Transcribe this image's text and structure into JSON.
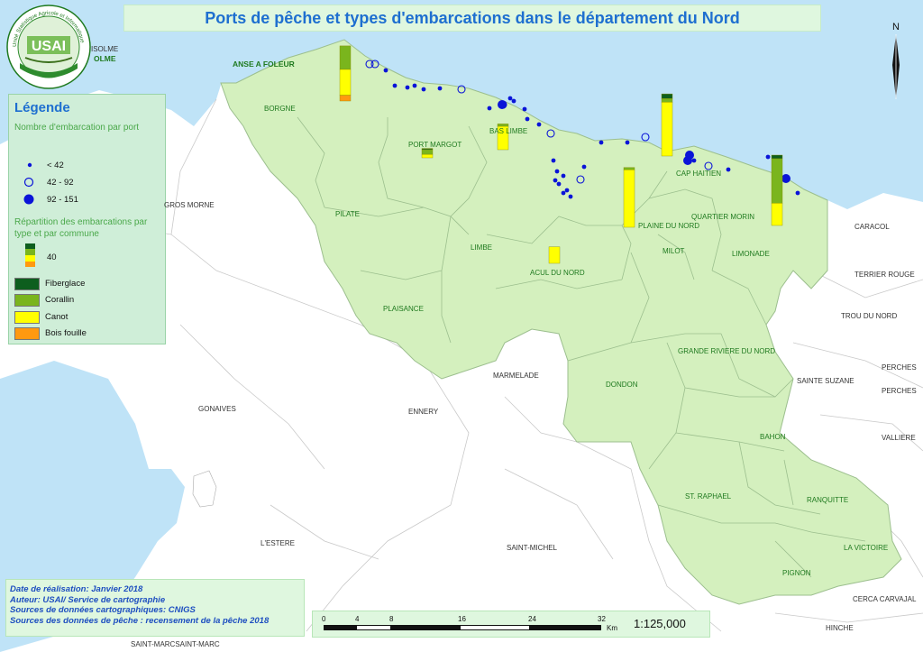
{
  "title": "Ports de pêche et types d'embarcations dans le département du Nord",
  "logo_text": "USAI",
  "logo_ring_text": "Unité Statistique Agricole et Informatique",
  "north_label": "N",
  "legend": {
    "title": "Légende",
    "port_heading": "Nombre d'embarcation par port",
    "port_classes": [
      "< 42",
      "42  - 92",
      "92 - 151"
    ],
    "commune_heading": "Répartition des embarcations par type et par commune",
    "sample_value": "40",
    "types": [
      {
        "label": "Fiberglace",
        "color": "#0d5e1e"
      },
      {
        "label": "Corallin",
        "color": "#7ab51d"
      },
      {
        "label": "Canot",
        "color": "#ffff00"
      },
      {
        "label": "Bois fouille",
        "color": "#ff9910"
      }
    ]
  },
  "footer": {
    "date": "Date de réalisation: Janvier 2018",
    "author": "Auteur: USAI/ Service de cartographie",
    "sources_carto": "Sources de données cartographiques: CNIGS",
    "sources_peche": "Sources des données de pêche : recensement de la pêche 2018"
  },
  "scale": {
    "ticks": [
      "0",
      "4",
      "8",
      "16",
      "24",
      "32"
    ],
    "unit": "Km",
    "ratio": "1:125,000"
  },
  "colors": {
    "sea": "#bfe3f7",
    "nord": "#d4f0be",
    "other_land": "#ffffff",
    "port_marker": "#0a14d8"
  },
  "communes_nord": [
    "BORGNE",
    "PORT MARGOT",
    "BAS LIMBE",
    "PILATE",
    "LIMBE",
    "ACUL DU NORD",
    "PLAINE DU NORD",
    "CAP HAITIEN",
    "QUARTIER MORIN",
    "MILOT",
    "LIMONADE",
    "PLAISANCE",
    "DONDON",
    "GRANDE RIVIERE DU NORD",
    "BAHON",
    "ST. RAPHAEL",
    "RANQUITTE",
    "LA VICTOIRE",
    "PIGNON"
  ],
  "other_communes": [
    "ANSE A FOLEUR",
    "ISOLME",
    "OLME",
    "GROS MORNE",
    "MARMELADE",
    "ENNERY",
    "GONAIVES",
    "L'ESTERE",
    "SAINT-MICHEL",
    "CARACOL",
    "TERRIER ROUGE",
    "TROU DU NORD",
    "PERCHES",
    "SAINTE SUZANE",
    "PERCHES",
    "VALLIERE",
    "CERCA CARVAJAL",
    "HINCHE",
    "SAINT-MARCSAINT-MARC"
  ],
  "commune_bars": [
    {
      "commune": "BORGNE",
      "fiberglace": 0,
      "corallin": 20,
      "canot": 22,
      "bois_fouille": 5
    },
    {
      "commune": "PORT MARGOT",
      "fiberglace": 1,
      "corallin": 4,
      "canot": 3,
      "bois_fouille": 0
    },
    {
      "commune": "BAS LIMBE",
      "fiberglace": 0,
      "corallin": 2,
      "canot": 20,
      "bois_fouille": 0
    },
    {
      "commune": "CAP HAITIEN",
      "fiberglace": 4,
      "corallin": 3,
      "canot": 46,
      "bois_fouille": 0
    },
    {
      "commune": "PLAINE DU NORD",
      "fiberglace": 0,
      "corallin": 2,
      "canot": 49,
      "bois_fouille": 0
    },
    {
      "commune": "ACUL DU NORD",
      "fiberglace": 0,
      "corallin": 0,
      "canot": 14,
      "bois_fouille": 0
    },
    {
      "commune": "LIMONADE",
      "fiberglace": 3,
      "corallin": 38,
      "canot": 19,
      "bois_fouille": 0
    }
  ]
}
